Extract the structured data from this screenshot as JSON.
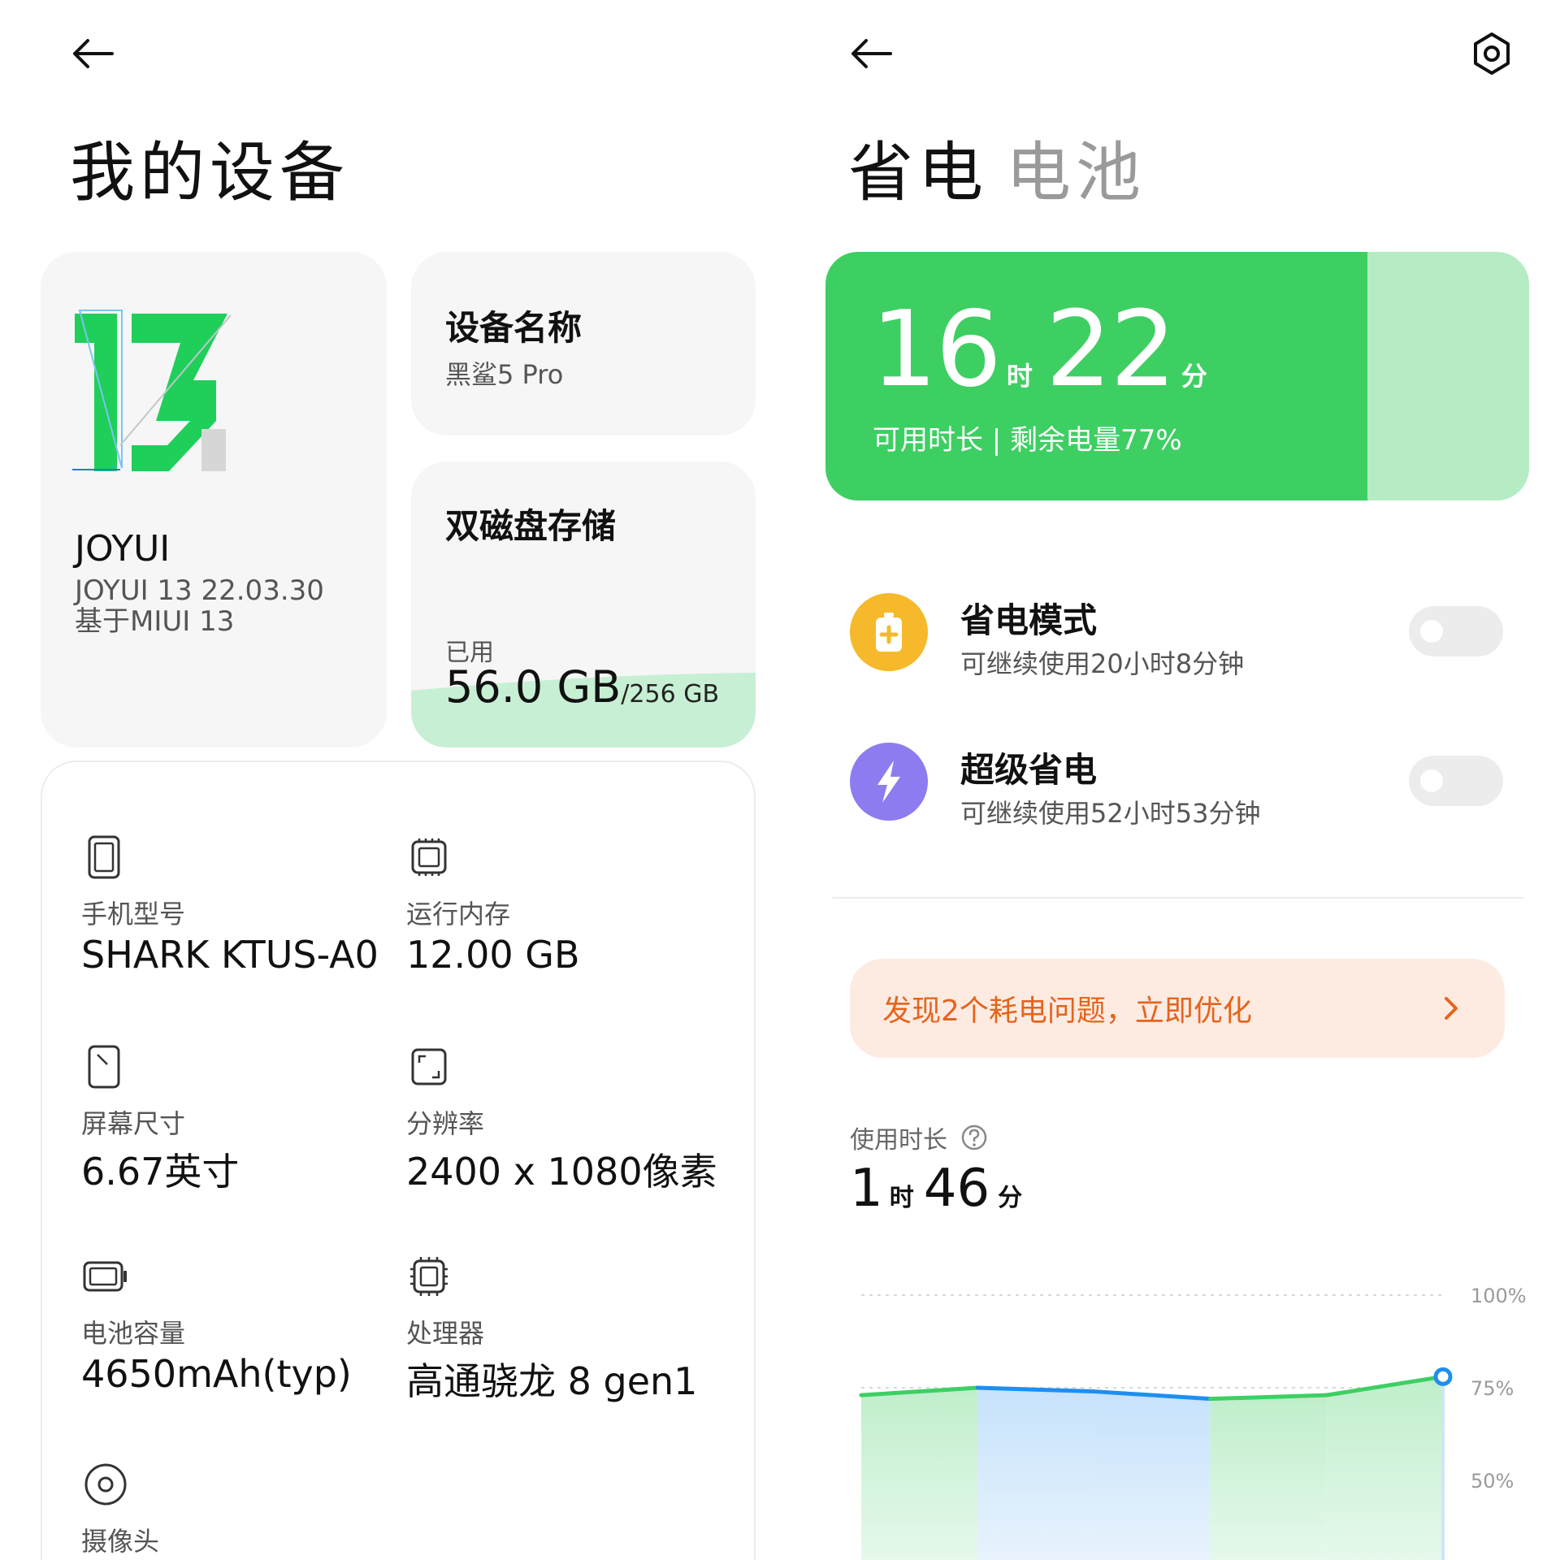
{
  "left": {
    "title": "我的设备",
    "os_card": {
      "logo_text": "13",
      "name": "JOYUI",
      "version": "JOYUI 13 22.03.30",
      "based_on": "基于MIUI 13"
    },
    "device_name_card": {
      "title": "设备名称",
      "value": "黑鲨5 Pro"
    },
    "storage_card": {
      "title": "双磁盘存储",
      "used_label": "已用",
      "used_value": "56.0 GB",
      "total": "/256 GB",
      "used_fraction": 0.219
    },
    "specs": [
      {
        "icon": "phone-icon",
        "label": "手机型号",
        "value": "SHARK KTUS-A0"
      },
      {
        "icon": "memory-chip-icon",
        "label": "运行内存",
        "value": "12.00 GB"
      },
      {
        "icon": "screen-size-icon",
        "label": "屏幕尺寸",
        "value": "6.67英寸"
      },
      {
        "icon": "resolution-icon",
        "label": "分辨率",
        "value": "2400 x 1080像素"
      },
      {
        "icon": "battery-icon",
        "label": "电池容量",
        "value": "4650mAh(typ)"
      },
      {
        "icon": "processor-icon",
        "label": "处理器",
        "value": "高通骁龙 8 gen1"
      },
      {
        "icon": "camera-icon",
        "label": "摄像头",
        "value": ""
      }
    ]
  },
  "right": {
    "tabs": [
      "省电",
      "电池"
    ],
    "battery": {
      "hours": "16",
      "hours_unit": "时",
      "minutes": "22",
      "minutes_unit": "分",
      "subtitle": "可用时长 | 剩余电量77%",
      "level_fraction": 0.77
    },
    "modes": [
      {
        "title": "省电模式",
        "sub": "可继续使用20小时8分钟",
        "color": "#f6b92b",
        "enabled": false
      },
      {
        "title": "超级省电",
        "sub": "可继续使用52小时53分钟",
        "color": "#8c7cf0",
        "enabled": false
      }
    ],
    "alert": {
      "text": "发现2个耗电问题，立即优化"
    },
    "usage": {
      "label": "使用时长",
      "hours": "1",
      "hours_unit": "时",
      "minutes": "46",
      "minutes_unit": "分"
    },
    "colors": {
      "green": "#3ecf63",
      "blue": "#1e8ff0",
      "alert_text": "#e5641c"
    }
  },
  "chart_data": {
    "type": "area",
    "y_ticks": [
      "100%",
      "75%",
      "50%"
    ],
    "ylim": [
      0,
      100
    ],
    "x": [
      0,
      1,
      2,
      3,
      4,
      5
    ],
    "series": [
      {
        "values": [
          73,
          75,
          74,
          72,
          73,
          78
        ]
      }
    ]
  }
}
